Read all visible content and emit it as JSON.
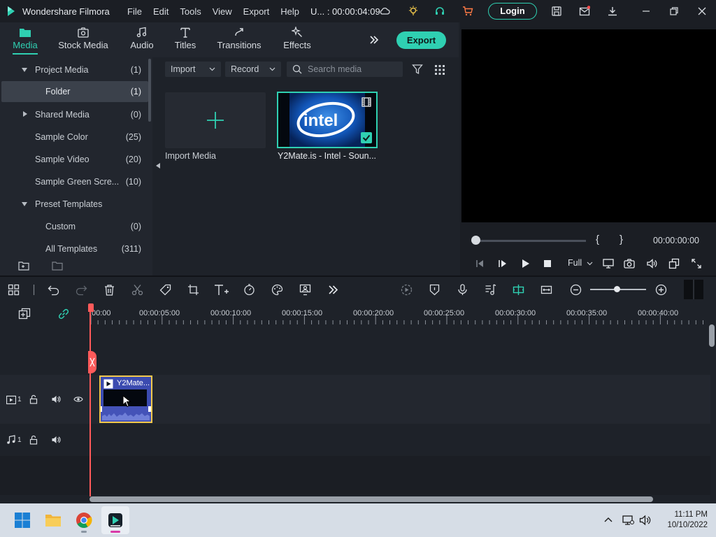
{
  "titlebar": {
    "app_name": "Wondershare Filmora",
    "menu": [
      "File",
      "Edit",
      "Tools",
      "View",
      "Export",
      "Help"
    ],
    "project_info": "U... : 00:00:04:09",
    "login_label": "Login"
  },
  "media_tabs": {
    "items": [
      {
        "label": "Media",
        "icon": "media-folder-icon",
        "active": true
      },
      {
        "label": "Stock Media",
        "icon": "stock-media-icon",
        "active": false
      },
      {
        "label": "Audio",
        "icon": "music-note-icon",
        "active": false
      },
      {
        "label": "Titles",
        "icon": "title-T-icon",
        "active": false
      },
      {
        "label": "Transitions",
        "icon": "transitions-icon",
        "active": false
      },
      {
        "label": "Effects",
        "icon": "effects-icon",
        "active": false
      }
    ],
    "export_label": "Export"
  },
  "sidebar": {
    "items": [
      {
        "label": "Project Media",
        "count": "(1)",
        "expand": "down"
      },
      {
        "label": "Folder",
        "count": "(1)",
        "selected": true
      },
      {
        "label": "Shared Media",
        "count": "(0)",
        "expand": "right"
      },
      {
        "label": "Sample Color",
        "count": "(25)"
      },
      {
        "label": "Sample Video",
        "count": "(20)"
      },
      {
        "label": "Sample Green Scre...",
        "count": "(10)"
      },
      {
        "label": "Preset Templates",
        "count": "",
        "expand": "down"
      },
      {
        "label": "Custom",
        "count": "(0)"
      },
      {
        "label": "All Templates",
        "count": "(311)"
      }
    ]
  },
  "media_toolbar": {
    "import_label": "Import",
    "record_label": "Record",
    "search_placeholder": "Search media"
  },
  "media_items": {
    "import_label": "Import Media",
    "clip_label": "Y2Mate.is - Intel - Soun...",
    "clip_logo_text": "intel"
  },
  "preview": {
    "timecode": "00:00:00:00",
    "brace_left": "{",
    "brace_right": "}",
    "quality": "Full",
    "progress": 0
  },
  "timeline": {
    "ruler_labels": [
      "00:00",
      "00:00:05:00",
      "00:00:10:00",
      "00:00:15:00",
      "00:00:20:00",
      "00:00:25:00",
      "00:00:30:00",
      "00:00:35:00",
      "00:00:40:00"
    ],
    "video_track_num": "1",
    "audio_track_num": "1",
    "clip_name": "Y2Mate..."
  },
  "taskbar": {
    "time": "11:11 PM",
    "date": "10/10/2022"
  },
  "colors": {
    "accent": "#2fd0b2",
    "clip_border": "#f1c84b",
    "playhead": "#ff5a5a"
  }
}
